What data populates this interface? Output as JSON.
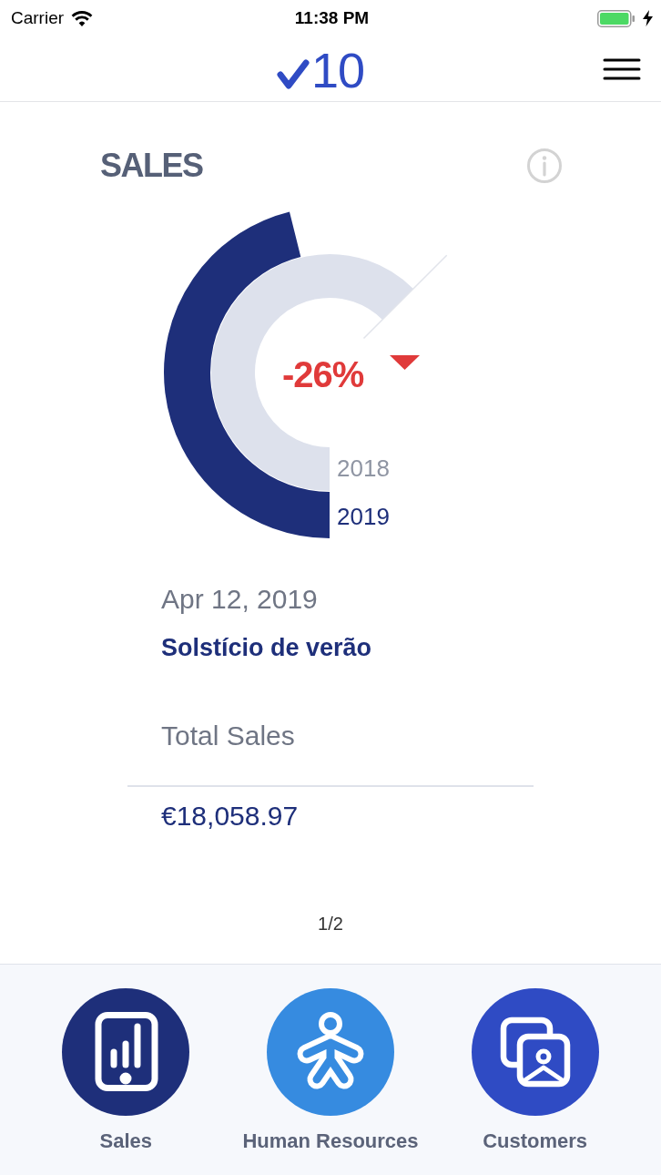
{
  "status_bar": {
    "carrier": "Carrier",
    "time": "11:38 PM",
    "charging": true
  },
  "nav_bar": {
    "logo_text": "10"
  },
  "card": {
    "title": "SALES",
    "change": {
      "text": "-26%",
      "decreasing": true
    },
    "series": [
      {
        "label": "2018",
        "color": "#dde1ec"
      },
      {
        "label": "2019",
        "color": "#1e2f7a"
      }
    ],
    "date": "Apr 12, 2019",
    "event": "Solstício de verão",
    "metric_label": "Total Sales",
    "metric_value": "€18,058.97"
  },
  "pager": "1/2",
  "tab_bar": {
    "items": [
      {
        "label": "Sales",
        "color": "#1e2f7a"
      },
      {
        "label": "Human Resources",
        "color": "#368be0"
      },
      {
        "label": "Customers",
        "color": "#2f4bc4"
      }
    ]
  }
}
